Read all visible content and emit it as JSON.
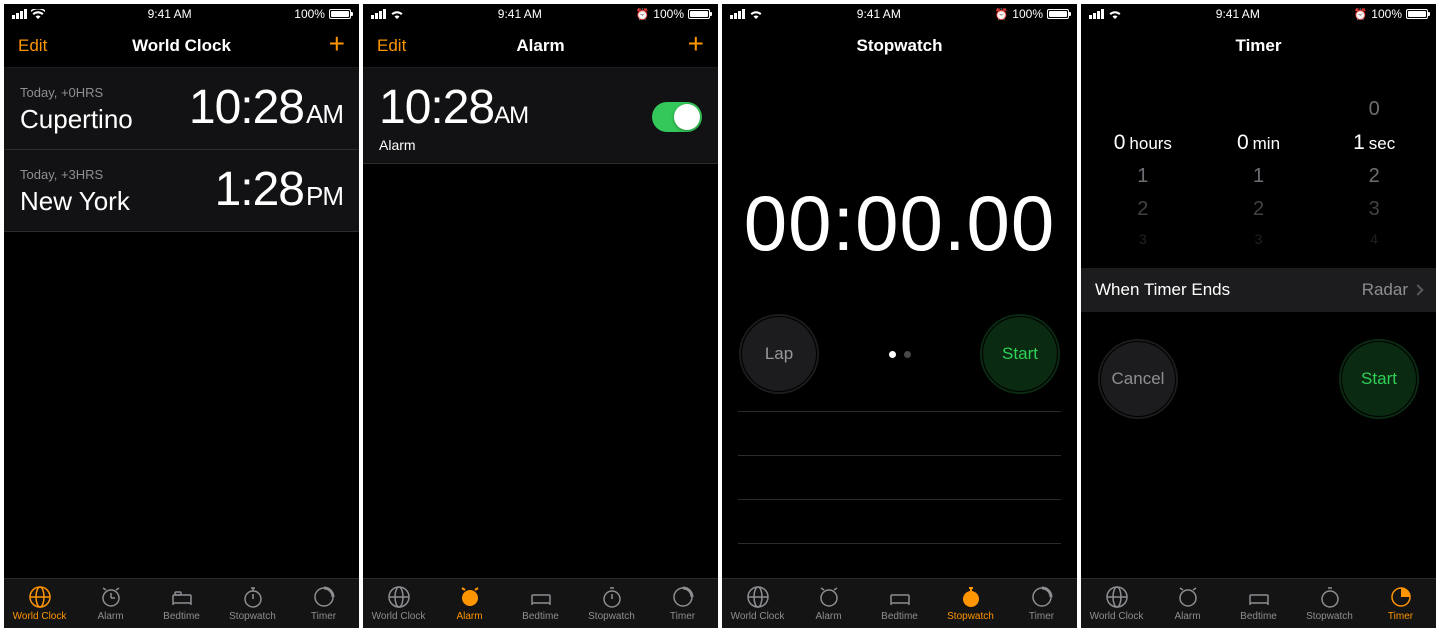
{
  "statusbar": {
    "time": "9:41 AM",
    "battery": "100%"
  },
  "screens": {
    "worldclock": {
      "nav": {
        "left": "Edit",
        "title": "World Clock",
        "right": "+"
      },
      "rows": [
        {
          "offset": "Today, +0HRS",
          "city": "Cupertino",
          "time": "10:28",
          "ampm": "AM"
        },
        {
          "offset": "Today, +3HRS",
          "city": "New York",
          "time": "1:28",
          "ampm": "PM"
        }
      ]
    },
    "alarm": {
      "nav": {
        "left": "Edit",
        "title": "Alarm",
        "right": "+"
      },
      "items": [
        {
          "time": "10:28",
          "ampm": "AM",
          "label": "Alarm",
          "on": true
        }
      ]
    },
    "stopwatch": {
      "nav": {
        "title": "Stopwatch"
      },
      "display": "00:00.00",
      "buttons": {
        "lap": "Lap",
        "start": "Start"
      }
    },
    "timer": {
      "nav": {
        "title": "Timer"
      },
      "picker": {
        "hours": {
          "value": "0",
          "unit": "hours",
          "below": [
            "1",
            "2",
            "3"
          ]
        },
        "min": {
          "value": "0",
          "unit": "min",
          "below": [
            "1",
            "2",
            "3"
          ]
        },
        "sec": {
          "above": "0",
          "value": "1",
          "unit": "sec",
          "below": [
            "2",
            "3",
            "4"
          ]
        }
      },
      "endrow": {
        "label": "When Timer Ends",
        "value": "Radar"
      },
      "buttons": {
        "cancel": "Cancel",
        "start": "Start"
      }
    }
  },
  "tabs": [
    "World Clock",
    "Alarm",
    "Bedtime",
    "Stopwatch",
    "Timer"
  ]
}
